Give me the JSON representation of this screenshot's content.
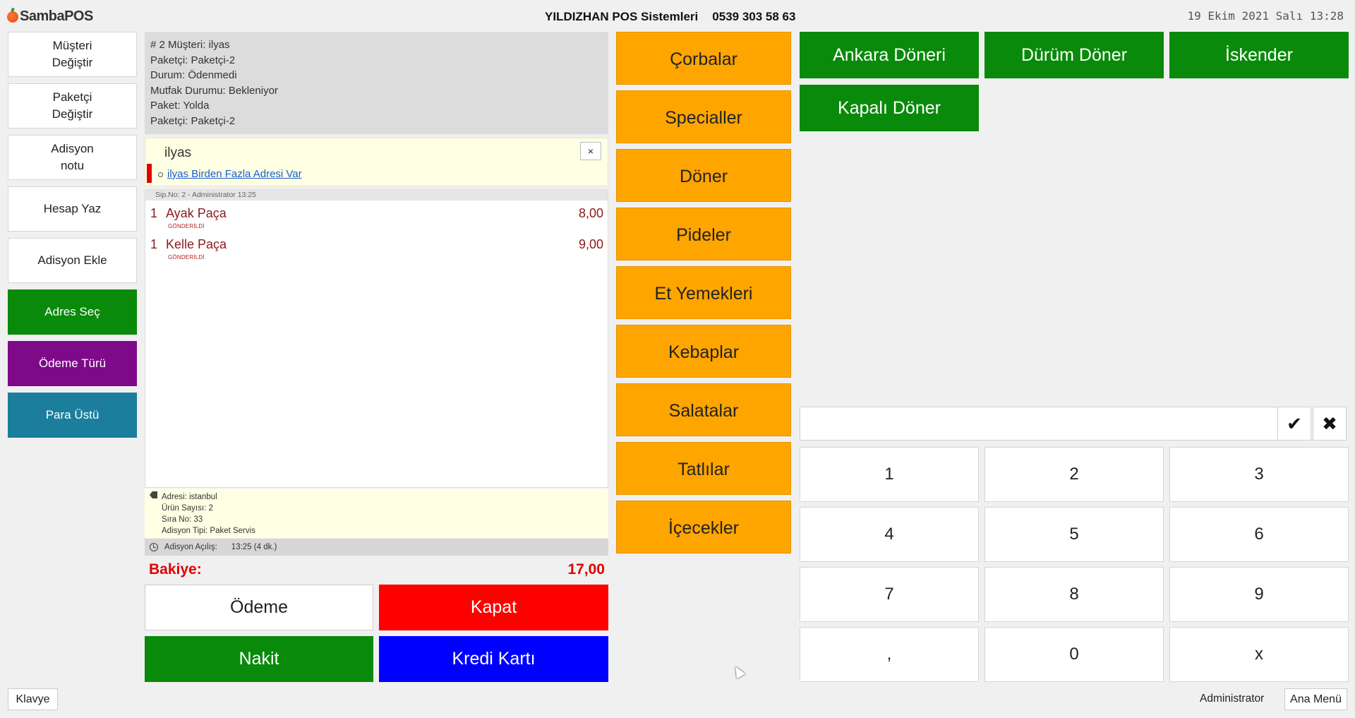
{
  "header": {
    "logo_text": "SambaPOS",
    "company": "YILDIZHAN POS Sistemleri",
    "phone": "0539 303 58 63",
    "datetime": "19 Ekim 2021 Salı 13:28"
  },
  "left_buttons": {
    "musteri": "Müşteri\nDeğiştir",
    "paketci": "Paketçi\nDeğiştir",
    "not": "Adisyon\nnotu",
    "hesap": "Hesap Yaz",
    "ekle": "Adisyon Ekle",
    "adres": "Adres Seç",
    "odeme_turu": "Ödeme Türü",
    "para_ustu": "Para Üstü"
  },
  "ticket": {
    "info_lines": [
      "# 2 Müşteri: ilyas",
      "Paketçi: Paketçi-2",
      "Durum: Ödenmedi",
      "Mutfak Durumu: Bekleniyor",
      "Paket: Yolda",
      "Paketçi: Paketçi-2"
    ],
    "customer_name": "ilyas",
    "close_label": "×",
    "customer_link": "ilyas Birden Fazla Adresi Var",
    "order_header": "Sip.No: 2 - Administrator  13:25",
    "orders": [
      {
        "qty": "1",
        "name": "Ayak Paça",
        "tag": "GÖNDERİLDİ",
        "price": "8,00"
      },
      {
        "qty": "1",
        "name": "Kelle Paça",
        "tag": "GÖNDERİLDİ",
        "price": "9,00"
      }
    ],
    "details": [
      "Adresi: istanbul",
      "Ürün Sayısı: 2",
      "Sıra No: 33",
      "Adisyon Tipi: Paket Servis"
    ],
    "opened_label": "Adisyon Açılış:",
    "opened_value": "13:25 (4 dk.)",
    "balance_label": "Bakiye:",
    "balance_value": "17,00"
  },
  "payment_buttons": {
    "odeme": "Ödeme",
    "kapat": "Kapat",
    "nakit": "Nakit",
    "kredi": "Kredi Kartı"
  },
  "categories": [
    "Çorbalar",
    "Specialler",
    "Döner",
    "Pideler",
    "Et Yemekleri",
    "Kebaplar",
    "Salatalar",
    "Tatlılar",
    "İçecekler"
  ],
  "products": [
    "Ankara Döneri",
    "Dürüm Döner",
    "İskender",
    "Kapalı Döner"
  ],
  "numpad": {
    "input_value": "",
    "ok_symbol": "✔",
    "cancel_symbol": "✖",
    "keys": [
      "1",
      "2",
      "3",
      "4",
      "5",
      "6",
      "7",
      "8",
      "9",
      ",",
      "0",
      "x"
    ]
  },
  "footer": {
    "keyboard": "Klavye",
    "user": "Administrator",
    "main_menu": "Ana Menü"
  },
  "colors": {
    "category": "#ffa500",
    "product": "#0a8a0a",
    "balance": "#e00000",
    "kapat": "#ff0000",
    "nakit": "#0a8a0a",
    "kredi": "#0000ff"
  }
}
